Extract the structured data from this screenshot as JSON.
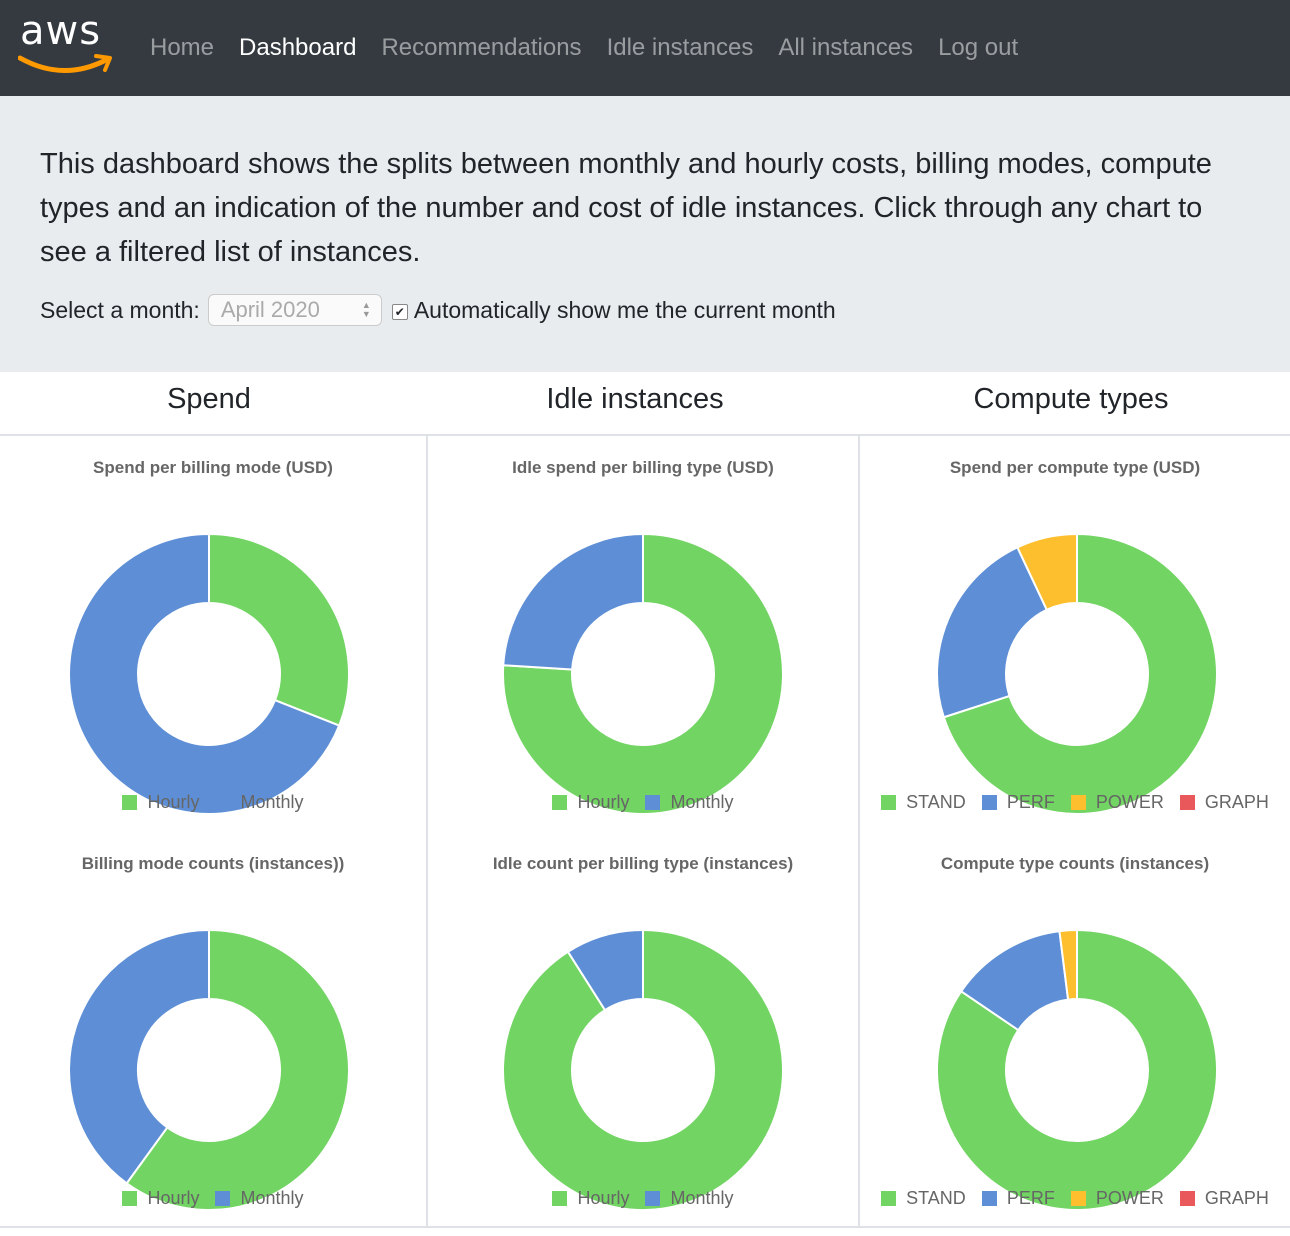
{
  "nav": {
    "logo_text": "aws",
    "items": [
      {
        "label": "Home",
        "active": false
      },
      {
        "label": "Dashboard",
        "active": true
      },
      {
        "label": "Recommendations",
        "active": false
      },
      {
        "label": "Idle instances",
        "active": false
      },
      {
        "label": "All instances",
        "active": false
      },
      {
        "label": "Log out",
        "active": false
      }
    ]
  },
  "intro": {
    "text": "This dashboard shows the splits between monthly and hourly costs, billing modes, compute types and an indication of the number and cost of idle instances. Click through any chart to see a filtered list of instances.",
    "month_label": "Select a month:",
    "month_value": "April 2020",
    "auto_checked": true,
    "auto_label": "Automatically show me the current month"
  },
  "columns": [
    "Spend",
    "Idle instances",
    "Compute types"
  ],
  "colors": {
    "green": "#72d463",
    "blue": "#5e8fd6",
    "yellow": "#fdbf2d",
    "red": "#e9585b"
  },
  "chart_data": [
    {
      "type": "pie",
      "title": "Spend per billing mode (USD)",
      "categories": [
        "Hourly",
        "Monthly"
      ],
      "values": [
        31,
        69
      ],
      "colors": [
        "#72d463",
        "#5e8fd6"
      ]
    },
    {
      "type": "pie",
      "title": "Idle spend per billing type (USD)",
      "categories": [
        "Hourly",
        "Monthly"
      ],
      "values": [
        76,
        24
      ],
      "colors": [
        "#72d463",
        "#5e8fd6"
      ]
    },
    {
      "type": "pie",
      "title": "Spend per compute type (USD)",
      "categories": [
        "STAND",
        "PERF",
        "POWER",
        "GRAPH"
      ],
      "values": [
        70,
        23,
        7,
        0
      ],
      "colors": [
        "#72d463",
        "#5e8fd6",
        "#fdbf2d",
        "#e9585b"
      ]
    },
    {
      "type": "pie",
      "title": "Billing mode counts (instances))",
      "categories": [
        "Hourly",
        "Monthly"
      ],
      "values": [
        60,
        40
      ],
      "colors": [
        "#72d463",
        "#5e8fd6"
      ]
    },
    {
      "type": "pie",
      "title": "Idle count per billing type (instances)",
      "categories": [
        "Hourly",
        "Monthly"
      ],
      "values": [
        91,
        9
      ],
      "colors": [
        "#72d463",
        "#5e8fd6"
      ]
    },
    {
      "type": "pie",
      "title": "Compute type counts (instances)",
      "categories": [
        "STAND",
        "PERF",
        "POWER",
        "GRAPH"
      ],
      "values": [
        84.5,
        13.5,
        2,
        0
      ],
      "colors": [
        "#72d463",
        "#5e8fd6",
        "#fdbf2d",
        "#e9585b"
      ]
    }
  ]
}
